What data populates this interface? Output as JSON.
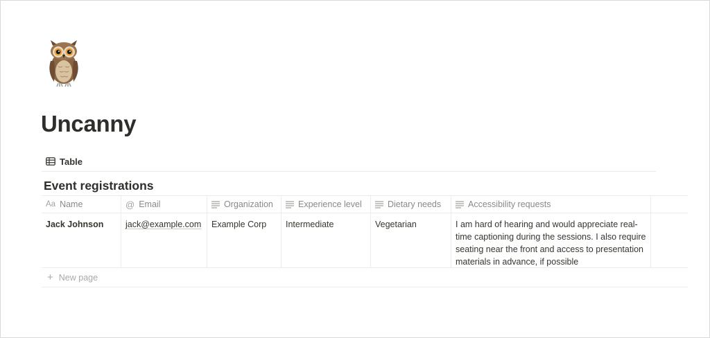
{
  "page": {
    "icon": "owl-emoji",
    "title": "Uncanny"
  },
  "views": {
    "active": {
      "label": "Table",
      "icon": "table-icon"
    }
  },
  "database": {
    "title": "Event registrations",
    "columns": [
      {
        "label": "Name",
        "icon": "title-aa-icon"
      },
      {
        "label": "Email",
        "icon": "at-icon"
      },
      {
        "label": "Organization",
        "icon": "text-lines-icon"
      },
      {
        "label": "Experience level",
        "icon": "text-lines-icon"
      },
      {
        "label": "Dietary needs",
        "icon": "text-lines-icon"
      },
      {
        "label": "Accessibility requests",
        "icon": "text-lines-icon"
      }
    ],
    "rows": [
      {
        "name": "Jack Johnson",
        "email": "jack@example.com",
        "organization": "Example Corp",
        "experience": "Intermediate",
        "dietary": "Vegetarian",
        "accessibility": "I am hard of hearing and would appreciate real-time captioning during the sessions. I also require seating near the front and access to presentation materials in advance, if possible"
      }
    ],
    "new_row_label": "New page",
    "title_icon_text": "Aa",
    "email_icon_text": "@",
    "plus_icon_text": "+"
  }
}
